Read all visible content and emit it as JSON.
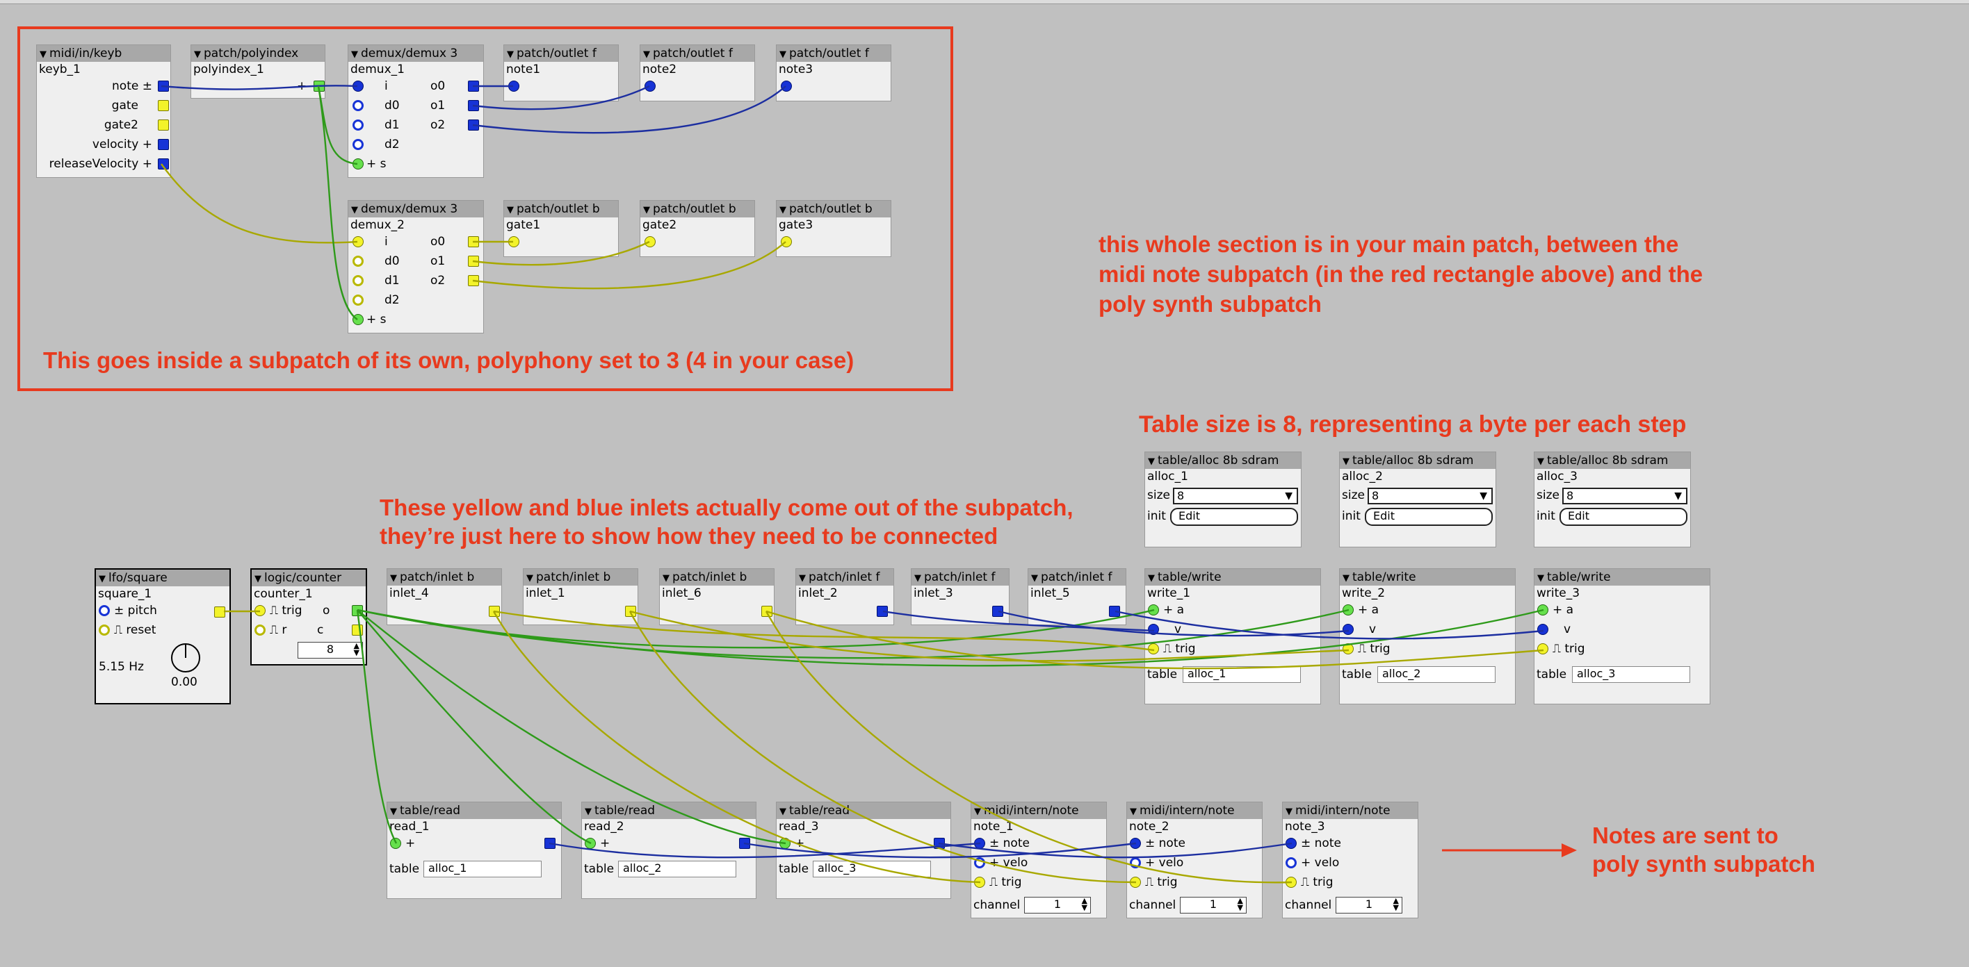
{
  "annotations": {
    "midi_box": "This goes inside a subpatch of its own, polyphony set to 3 (4 in your case)",
    "main_patch_1": "this whole section is in your main patch, between the",
    "main_patch_2": "midi note subpatch (in the red rectangle above) and the",
    "main_patch_3": "poly synth subpatch",
    "table_size": "Table size is 8, representing a byte per each step",
    "inlets_1": "These yellow and blue inlets actually come out of the subpatch,",
    "inlets_2": "they’re just here to show how they need to be connected",
    "notes_1": "Notes are sent to",
    "notes_2": "poly synth subpatch"
  },
  "colors": {
    "accent": "#e83a1e",
    "pin_blue": "#1733d6",
    "pin_yellow": "#f3f32a",
    "pin_green": "#66e04c",
    "wire_blue": "#1c2ea0",
    "wire_yellow": "#a8a800",
    "wire_green": "#2e9a1a"
  },
  "objects": {
    "keyb": {
      "title": "midi/in/keyb",
      "instance": "keyb_1",
      "outs": [
        "note",
        "gate",
        "gate2",
        "velocity",
        "releaseVelocity"
      ],
      "prefixes": [
        "±",
        "",
        "",
        "+",
        "+"
      ]
    },
    "polyindex": {
      "title": "patch/polyindex",
      "instance": "polyindex_1",
      "prefix": "+"
    },
    "demux1": {
      "title": "demux/demux 3",
      "instance": "demux_1",
      "ins": [
        "i",
        "d0",
        "d1",
        "d2",
        "s"
      ],
      "outs": [
        "o0",
        "o1",
        "o2"
      ],
      "s_prefix": "+"
    },
    "demux2": {
      "title": "demux/demux 3",
      "instance": "demux_2",
      "ins": [
        "i",
        "d0",
        "d1",
        "d2",
        "s"
      ],
      "outs": [
        "o0",
        "o1",
        "o2"
      ],
      "s_prefix": "+"
    },
    "outf1": {
      "title": "patch/outlet f",
      "instance": "note1"
    },
    "outf2": {
      "title": "patch/outlet f",
      "instance": "note2"
    },
    "outf3": {
      "title": "patch/outlet f",
      "instance": "note3"
    },
    "outb1": {
      "title": "patch/outlet b",
      "instance": "gate1"
    },
    "outb2": {
      "title": "patch/outlet b",
      "instance": "gate2"
    },
    "outb3": {
      "title": "patch/outlet b",
      "instance": "gate3"
    },
    "lfo": {
      "title": "lfo/square",
      "instance": "square_1",
      "pitch": "pitch",
      "pitch_prefix": "±",
      "reset": "reset",
      "freq": "5.15 Hz",
      "knob_value": "0.00"
    },
    "counter": {
      "title": "logic/counter",
      "instance": "counter_1",
      "trig": "trig",
      "r": "r",
      "o": "o",
      "c": "c",
      "value": "8"
    },
    "inb4": {
      "title": "patch/inlet b",
      "instance": "inlet_4"
    },
    "inb1": {
      "title": "patch/inlet b",
      "instance": "inlet_1"
    },
    "inb6": {
      "title": "patch/inlet b",
      "instance": "inlet_6"
    },
    "inf2": {
      "title": "patch/inlet f",
      "instance": "inlet_2"
    },
    "inf3": {
      "title": "patch/inlet f",
      "instance": "inlet_3"
    },
    "inf5": {
      "title": "patch/inlet f",
      "instance": "inlet_5"
    },
    "alloc1": {
      "title": "table/alloc 8b sdram",
      "instance": "alloc_1",
      "size_label": "size",
      "size": "8",
      "init_label": "init",
      "init": "Edit"
    },
    "alloc2": {
      "title": "table/alloc 8b sdram",
      "instance": "alloc_2",
      "size_label": "size",
      "size": "8",
      "init_label": "init",
      "init": "Edit"
    },
    "alloc3": {
      "title": "table/alloc 8b sdram",
      "instance": "alloc_3",
      "size_label": "size",
      "size": "8",
      "init_label": "init",
      "init": "Edit"
    },
    "write1": {
      "title": "table/write",
      "instance": "write_1",
      "a": "a",
      "v": "v",
      "trig": "trig",
      "table_label": "table",
      "table": "alloc_1",
      "a_prefix": "+"
    },
    "write2": {
      "title": "table/write",
      "instance": "write_2",
      "a": "a",
      "v": "v",
      "trig": "trig",
      "table_label": "table",
      "table": "alloc_2",
      "a_prefix": "+"
    },
    "write3": {
      "title": "table/write",
      "instance": "write_3",
      "a": "a",
      "v": "v",
      "trig": "trig",
      "table_label": "table",
      "table": "alloc_3",
      "a_prefix": "+"
    },
    "read1": {
      "title": "table/read",
      "instance": "read_1",
      "table_label": "table",
      "table": "alloc_1",
      "prefix": "+"
    },
    "read2": {
      "title": "table/read",
      "instance": "read_2",
      "table_label": "table",
      "table": "alloc_2",
      "prefix": "+"
    },
    "read3": {
      "title": "table/read",
      "instance": "read_3",
      "table_label": "table",
      "table": "alloc_3",
      "prefix": "+"
    },
    "note1": {
      "title": "midi/intern/note",
      "instance": "note_1",
      "note": "note",
      "velo": "velo",
      "trig": "trig",
      "channel_label": "channel",
      "channel": "1",
      "note_prefix": "±",
      "velo_prefix": "+"
    },
    "note2": {
      "title": "midi/intern/note",
      "instance": "note_2",
      "note": "note",
      "velo": "velo",
      "trig": "trig",
      "channel_label": "channel",
      "channel": "1",
      "note_prefix": "±",
      "velo_prefix": "+"
    },
    "note3": {
      "title": "midi/intern/note",
      "instance": "note_3",
      "note": "note",
      "velo": "velo",
      "trig": "trig",
      "channel_label": "channel",
      "channel": "1",
      "note_prefix": "±",
      "velo_prefix": "+"
    }
  }
}
